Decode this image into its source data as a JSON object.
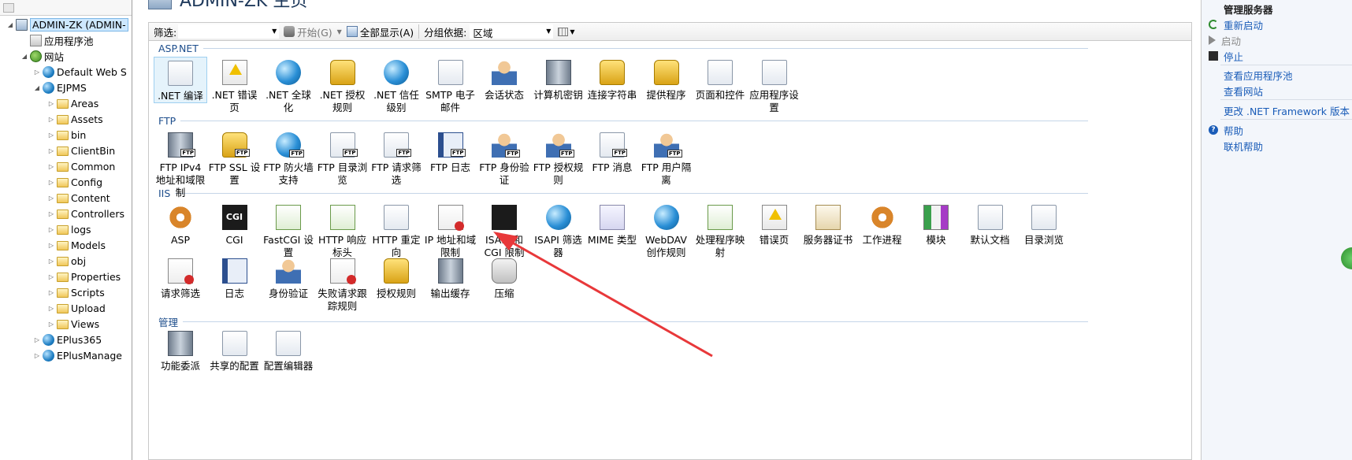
{
  "tree": {
    "items": [
      {
        "label": "ADMIN-ZK (ADMIN-",
        "icon": "server-icon",
        "expander": "◢"
      },
      {
        "label": "应用程序池",
        "icon": "app-pool-icon",
        "expander": ""
      },
      {
        "label": "网站",
        "icon": "sites-icon",
        "expander": "◢"
      },
      {
        "label": "Default Web S",
        "icon": "globe-icon",
        "expander": "▷"
      },
      {
        "label": "EJPMS",
        "icon": "globe-icon",
        "expander": "◢"
      },
      {
        "label": "Areas",
        "icon": "folder-icon",
        "expander": "▷"
      },
      {
        "label": "Assets",
        "icon": "folder-icon",
        "expander": "▷"
      },
      {
        "label": "bin",
        "icon": "folder-icon",
        "expander": "▷"
      },
      {
        "label": "ClientBin",
        "icon": "folder-icon",
        "expander": "▷"
      },
      {
        "label": "Common",
        "icon": "folder-icon",
        "expander": "▷"
      },
      {
        "label": "Config",
        "icon": "folder-icon",
        "expander": "▷"
      },
      {
        "label": "Content",
        "icon": "folder-icon",
        "expander": "▷"
      },
      {
        "label": "Controllers",
        "icon": "folder-icon",
        "expander": "▷"
      },
      {
        "label": "logs",
        "icon": "folder-icon",
        "expander": "▷"
      },
      {
        "label": "Models",
        "icon": "folder-icon",
        "expander": "▷"
      },
      {
        "label": "obj",
        "icon": "folder-icon",
        "expander": "▷"
      },
      {
        "label": "Properties",
        "icon": "folder-icon",
        "expander": "▷"
      },
      {
        "label": "Scripts",
        "icon": "folder-icon",
        "expander": "▷"
      },
      {
        "label": "Upload",
        "icon": "folder-icon",
        "expander": "▷"
      },
      {
        "label": "Views",
        "icon": "folder-icon",
        "expander": "▷"
      },
      {
        "label": "EPlus365",
        "icon": "globe-icon",
        "expander": "▷"
      },
      {
        "label": "EPlusManage",
        "icon": "globe-icon",
        "expander": "▷"
      }
    ]
  },
  "header": {
    "title": "ADMIN-ZK 主页"
  },
  "filterbar": {
    "filter_label": "筛选:",
    "filter_value": "",
    "start_label": "开始(G)",
    "show_all_label": "全部显示(A)",
    "group_label": "分组依据:",
    "group_value": "区域"
  },
  "sections": {
    "aspnet": "ASP.NET",
    "ftp": "FTP",
    "iis": "IIS",
    "manage": "管理"
  },
  "features": {
    "aspnet": [
      {
        "label": ".NET 编译",
        "icon": "compile-icon",
        "selected": true
      },
      {
        "label": ".NET 错误页",
        "icon": "error-page-icon"
      },
      {
        "label": ".NET 全球化",
        "icon": "globalization-icon"
      },
      {
        "label": ".NET 授权规则",
        "icon": "authorization-icon"
      },
      {
        "label": ".NET 信任级别",
        "icon": "trust-level-icon"
      },
      {
        "label": "SMTP 电子邮件",
        "icon": "smtp-icon"
      },
      {
        "label": "会话状态",
        "icon": "session-state-icon"
      },
      {
        "label": "计算机密钥",
        "icon": "machine-key-icon"
      },
      {
        "label": "连接字符串",
        "icon": "connection-string-icon"
      },
      {
        "label": "提供程序",
        "icon": "providers-icon"
      },
      {
        "label": "页面和控件",
        "icon": "pages-controls-icon"
      },
      {
        "label": "应用程序设置",
        "icon": "app-settings-icon"
      }
    ],
    "ftp": [
      {
        "label": "FTP IPv4 地址和域限制",
        "icon": "ftp-ip-icon"
      },
      {
        "label": "FTP SSL 设置",
        "icon": "ftp-ssl-icon"
      },
      {
        "label": "FTP 防火墙支持",
        "icon": "ftp-firewall-icon"
      },
      {
        "label": "FTP 目录浏览",
        "icon": "ftp-directory-icon"
      },
      {
        "label": "FTP 请求筛选",
        "icon": "ftp-request-filter-icon"
      },
      {
        "label": "FTP 日志",
        "icon": "ftp-logging-icon"
      },
      {
        "label": "FTP 身份验证",
        "icon": "ftp-auth-icon"
      },
      {
        "label": "FTP 授权规则",
        "icon": "ftp-authz-icon"
      },
      {
        "label": "FTP 消息",
        "icon": "ftp-messages-icon"
      },
      {
        "label": "FTP 用户隔离",
        "icon": "ftp-isolation-icon"
      }
    ],
    "iis_row1": [
      {
        "label": "ASP",
        "icon": "asp-icon"
      },
      {
        "label": "CGI",
        "icon": "cgi-icon"
      },
      {
        "label": "FastCGI 设置",
        "icon": "fastcgi-icon"
      },
      {
        "label": "HTTP 响应标头",
        "icon": "http-headers-icon"
      },
      {
        "label": "HTTP 重定向",
        "icon": "http-redirect-icon"
      },
      {
        "label": "IP 地址和域限制",
        "icon": "ip-restrictions-icon"
      },
      {
        "label": "ISAPI 和 CGI 限制",
        "icon": "isapi-cgi-icon"
      },
      {
        "label": "ISAPI 筛选器",
        "icon": "isapi-filter-icon"
      },
      {
        "label": "MIME 类型",
        "icon": "mime-icon"
      },
      {
        "label": "WebDAV 创作规则",
        "icon": "webdav-icon"
      },
      {
        "label": "处理程序映射",
        "icon": "handler-mapping-icon"
      },
      {
        "label": "错误页",
        "icon": "error-pages-icon"
      },
      {
        "label": "服务器证书",
        "icon": "server-cert-icon"
      },
      {
        "label": "工作进程",
        "icon": "worker-process-icon"
      },
      {
        "label": "模块",
        "icon": "modules-icon"
      },
      {
        "label": "默认文档",
        "icon": "default-document-icon"
      },
      {
        "label": "目录浏览",
        "icon": "directory-browsing-icon"
      }
    ],
    "iis_row2": [
      {
        "label": "请求筛选",
        "icon": "request-filtering-icon"
      },
      {
        "label": "日志",
        "icon": "logging-icon"
      },
      {
        "label": "身份验证",
        "icon": "authentication-icon"
      },
      {
        "label": "失败请求跟踪规则",
        "icon": "failed-request-icon"
      },
      {
        "label": "授权规则",
        "icon": "authorization-rules-icon"
      },
      {
        "label": "输出缓存",
        "icon": "output-cache-icon"
      },
      {
        "label": "压缩",
        "icon": "compression-icon"
      }
    ],
    "manage": [
      {
        "label": "功能委派",
        "icon": "feature-delegation-icon"
      },
      {
        "label": "共享的配置",
        "icon": "shared-config-icon"
      },
      {
        "label": "配置编辑器",
        "icon": "config-editor-icon"
      }
    ]
  },
  "actions": {
    "head": "管理服务器",
    "restart": "重新启动",
    "start": "启动",
    "stop": "停止",
    "view_pools": "查看应用程序池",
    "view_sites": "查看网站",
    "change_framework": "更改 .NET Framework 版本",
    "help": "帮助",
    "online_help": "联机帮助"
  },
  "colors": {
    "link": "#1a5cb8",
    "section": "#1e4e8c",
    "arrow": "#e8383a"
  }
}
